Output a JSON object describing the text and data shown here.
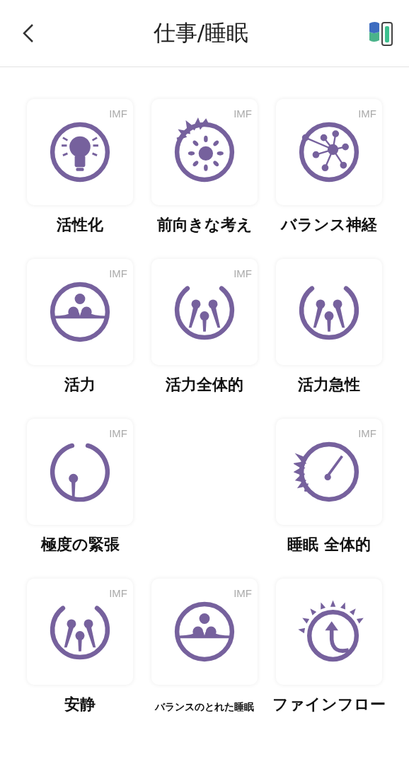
{
  "header": {
    "title": "仕事/睡眠"
  },
  "rows": [
    [
      {
        "label": "活性化",
        "badge": "IMF",
        "kind": "bulb"
      },
      {
        "label": "前向きな考え",
        "badge": "IMF",
        "kind": "sun"
      },
      {
        "label": "バランス神経",
        "badge": "IMF",
        "kind": "network"
      }
    ],
    [
      {
        "label": "活力",
        "badge": "IMF",
        "kind": "balance"
      },
      {
        "label": "活力全体的",
        "badge": "IMF",
        "kind": "drops"
      },
      {
        "label": "活力急性",
        "kind": "drops"
      }
    ],
    [
      {
        "label": "極度の緊張",
        "badge": "IMF",
        "kind": "drop"
      },
      null,
      {
        "label": "睡眠 全体的",
        "badge": "IMF",
        "kind": "dial"
      }
    ],
    [
      {
        "label": "安静",
        "badge": "IMF",
        "kind": "drops"
      },
      {
        "label": "バランスのとれた睡眠",
        "badge": "IMF",
        "kind": "balance",
        "small": true
      },
      {
        "label": "ファインフロー",
        "kind": "flow"
      }
    ]
  ]
}
